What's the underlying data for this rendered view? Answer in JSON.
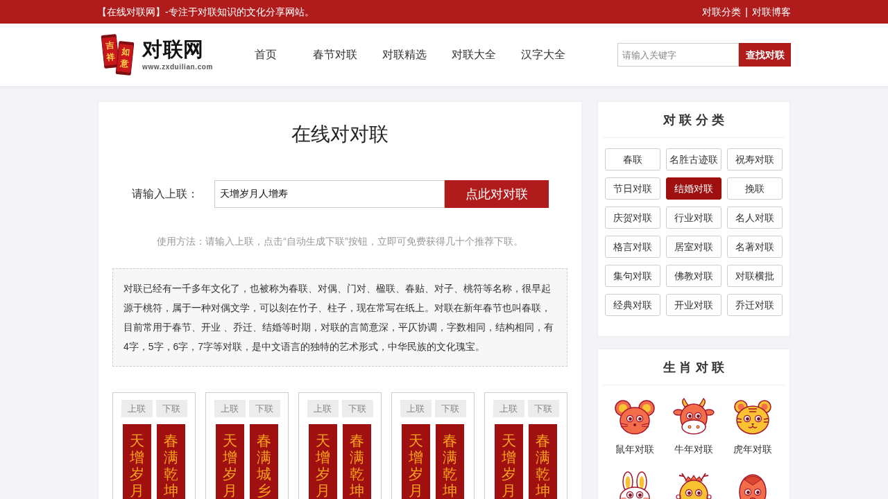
{
  "top_bar": {
    "slogan": "【在线对联网】-专注于对联知识的文化分享网站。",
    "links": [
      "对联分类",
      "对联博客"
    ],
    "separator": "|"
  },
  "header": {
    "logo": {
      "scrolls": [
        "吉祥",
        "如意"
      ],
      "title": "对联网",
      "url": "www.zxduilian.com"
    },
    "nav": [
      {
        "label": "首页"
      },
      {
        "label": "春节对联"
      },
      {
        "label": "对联精选"
      },
      {
        "label": "对联大全"
      },
      {
        "label": "汉字大全"
      }
    ],
    "search": {
      "placeholder": "请输入关键字",
      "button": "查找对联"
    }
  },
  "main": {
    "title": "在线对对联",
    "form": {
      "label": "请输入上联：",
      "value": "天增岁月人增寿",
      "button": "点此对对联"
    },
    "hint": "使用方法：请输入上联，点击“自动生成下联”按钮，立即可免费获得几十个推荐下联。",
    "intro": "对联已经有一千多年文化了，也被称为春联、对偶、门对、楹联、春贴、对子、桃符等名称，很早起源于桃符，属于一种对偶文学，可以刻在竹子、柱子，现在常写在纸上。对联在新年春节也叫春联，目前常用于春节、开业 、乔迁、结婚等时期，对联的言简意深，平仄协调，字数相同，结构相同，有4字，5字，6字，7字等对联，是中文语言的独特的艺术形式，中华民族的文化瑰宝。",
    "couplets": [
      {
        "tabs": [
          "上联",
          "下联"
        ],
        "upper": "天增岁月",
        "lower": "春满乾坤"
      },
      {
        "tabs": [
          "上联",
          "下联"
        ],
        "upper": "天增岁月",
        "lower": "春满城乡"
      },
      {
        "tabs": [
          "上联",
          "下联"
        ],
        "upper": "天增岁月",
        "lower": "春满乾坤"
      },
      {
        "tabs": [
          "上联",
          "下联"
        ],
        "upper": "天增岁月",
        "lower": "春满乾坤"
      },
      {
        "tabs": [
          "上联",
          "下联"
        ],
        "upper": "天增岁月",
        "lower": "春满乾坤"
      }
    ]
  },
  "sidebar": {
    "categories": {
      "title": "对联分类",
      "items": [
        {
          "label": "春联",
          "selected": false
        },
        {
          "label": "名胜古迹联",
          "selected": false
        },
        {
          "label": "祝寿对联",
          "selected": false
        },
        {
          "label": "节日对联",
          "selected": false
        },
        {
          "label": "结婚对联",
          "selected": true
        },
        {
          "label": "挽联",
          "selected": false
        },
        {
          "label": "庆贺对联",
          "selected": false
        },
        {
          "label": "行业对联",
          "selected": false
        },
        {
          "label": "名人对联",
          "selected": false
        },
        {
          "label": "格言对联",
          "selected": false
        },
        {
          "label": "居室对联",
          "selected": false
        },
        {
          "label": "名著对联",
          "selected": false
        },
        {
          "label": "集句对联",
          "selected": false
        },
        {
          "label": "佛教对联",
          "selected": false
        },
        {
          "label": "对联横批",
          "selected": false
        },
        {
          "label": "经典对联",
          "selected": false
        },
        {
          "label": "开业对联",
          "selected": false
        },
        {
          "label": "乔迁对联",
          "selected": false
        }
      ]
    },
    "zodiac": {
      "title": "生肖对联",
      "items": [
        {
          "kind": "rat",
          "label": "鼠年对联"
        },
        {
          "kind": "ox",
          "label": "牛年对联"
        },
        {
          "kind": "tiger",
          "label": "虎年对联"
        },
        {
          "kind": "rabbit"
        },
        {
          "kind": "dragon"
        },
        {
          "kind": "snake"
        }
      ]
    }
  }
}
